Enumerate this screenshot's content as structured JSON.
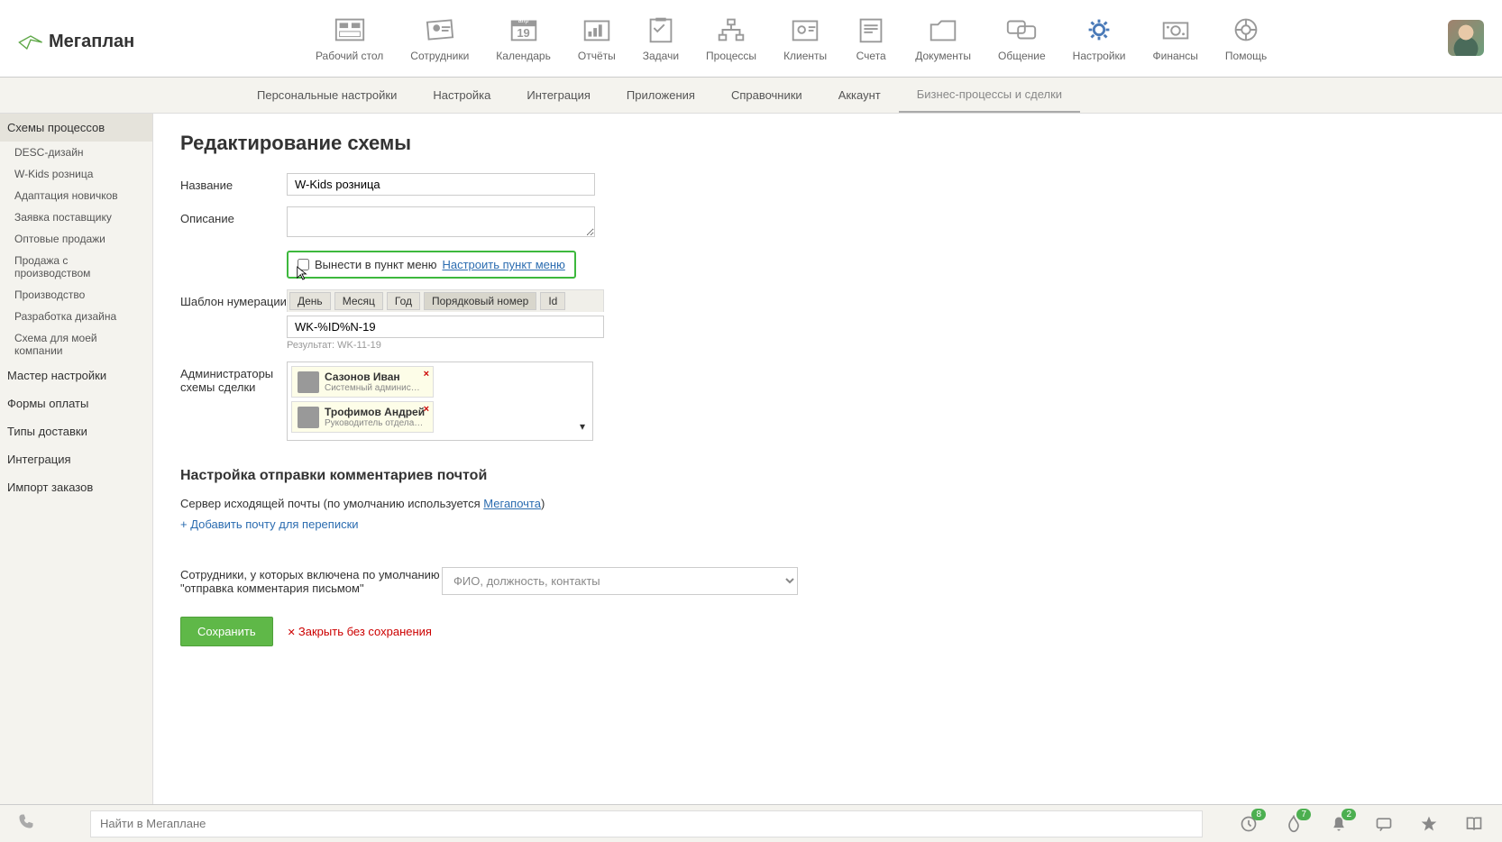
{
  "logo": "Мегаплан",
  "nav": {
    "items": [
      {
        "label": "Рабочий стол"
      },
      {
        "label": "Сотрудники"
      },
      {
        "label": "Календарь"
      },
      {
        "label": "Отчёты"
      },
      {
        "label": "Задачи"
      },
      {
        "label": "Процессы"
      },
      {
        "label": "Клиенты"
      },
      {
        "label": "Счета"
      },
      {
        "label": "Документы"
      },
      {
        "label": "Общение"
      },
      {
        "label": "Настройки"
      },
      {
        "label": "Финансы"
      },
      {
        "label": "Помощь"
      }
    ]
  },
  "subnav": {
    "items": [
      {
        "label": "Персональные настройки"
      },
      {
        "label": "Настройка"
      },
      {
        "label": "Интеграция"
      },
      {
        "label": "Приложения"
      },
      {
        "label": "Справочники"
      },
      {
        "label": "Аккаунт"
      },
      {
        "label": "Бизнес-процессы и сделки"
      }
    ]
  },
  "sidebar": {
    "groups": [
      {
        "label": "Схемы процессов",
        "active": true
      },
      {
        "label": "Мастер настройки"
      },
      {
        "label": "Формы оплаты"
      },
      {
        "label": "Типы доставки"
      },
      {
        "label": "Интеграция"
      },
      {
        "label": "Импорт заказов"
      }
    ],
    "subs": [
      {
        "label": "DESC-дизайн"
      },
      {
        "label": "W-Kids розница"
      },
      {
        "label": "Адаптация новичков"
      },
      {
        "label": "Заявка поставщику"
      },
      {
        "label": "Оптовые продажи"
      },
      {
        "label": "Продажа с производством"
      },
      {
        "label": "Производство"
      },
      {
        "label": "Разработка дизайна"
      },
      {
        "label": "Схема для моей компании"
      }
    ]
  },
  "page": {
    "title": "Редактирование схемы",
    "labels": {
      "name": "Название",
      "desc": "Описание",
      "num": "Шаблон нумерации",
      "admins": "Администраторы схемы сделки"
    },
    "name_value": "W-Kids розница",
    "desc_value": "",
    "menu_checkbox_label": "Вынести в пункт меню",
    "menu_link": "Настроить пункт меню",
    "num_tags": [
      "День",
      "Месяц",
      "Год",
      "Порядковый номер",
      "Id"
    ],
    "num_value": "WK-%ID%N-19",
    "num_result_label": "Результат:",
    "num_result": "WK-11-19",
    "admins": [
      {
        "name": "Сазонов Иван",
        "role": "Системный администратор"
      },
      {
        "name": "Трофимов Андрей",
        "role": "Руководитель отдела пр..."
      }
    ],
    "mail_title": "Настройка отправки комментариев почтой",
    "mail_text_prefix": "Сервер исходящей почты (по умолчанию используется ",
    "mail_link": "Мегапочта",
    "mail_text_suffix": ")",
    "add_mail": "+ Добавить почту для переписки",
    "emp_label": "Сотрудники, у которых включена по умолчанию \"отправка комментария письмом\"",
    "emp_placeholder": "ФИО, должность, контакты",
    "save": "Сохранить",
    "cancel": "Закрыть без сохранения"
  },
  "bottombar": {
    "search_placeholder": "Найти в Мегаплане",
    "badges": {
      "clock": "8",
      "fire": "7",
      "bell": "2"
    }
  },
  "calendar_icon_day": "19",
  "calendar_icon_month": "апр"
}
